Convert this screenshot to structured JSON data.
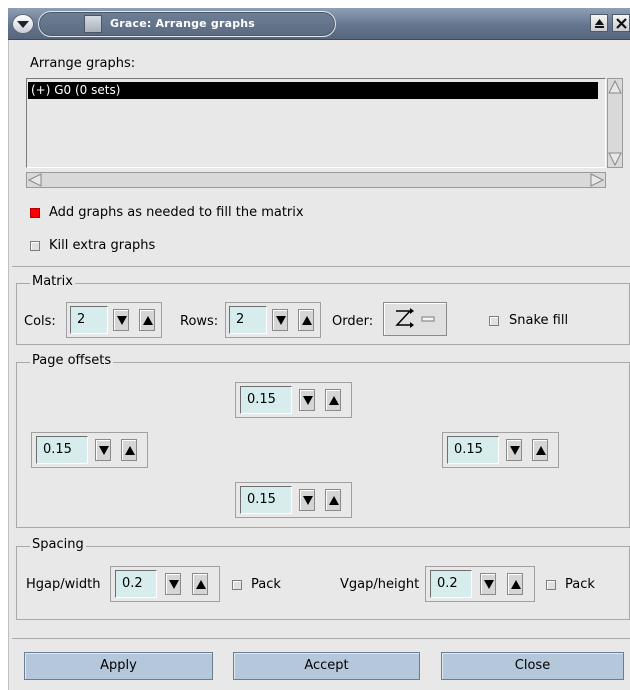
{
  "window": {
    "title": "Grace: Arrange graphs",
    "menu_icon": "chevron-down-icon",
    "app_icon": "grace-app-icon",
    "controls": [
      "maximize-icon",
      "close-icon"
    ]
  },
  "graphs": {
    "label": "Arrange graphs:",
    "items": [
      "(+) G0 (0 sets)"
    ],
    "add_graphs": {
      "label": "Add graphs as needed to fill the matrix",
      "checked": true
    },
    "kill_extra": {
      "label": "Kill extra graphs",
      "checked": false
    }
  },
  "matrix": {
    "title": "Matrix",
    "cols_label": "Cols:",
    "cols_value": "2",
    "rows_label": "Rows:",
    "rows_value": "2",
    "order_label": "Order:",
    "order_icon": "order-zigzag-icon",
    "snake_fill": {
      "label": "Snake fill",
      "checked": false
    }
  },
  "page_offsets": {
    "title": "Page offsets",
    "top": "0.15",
    "left": "0.15",
    "right": "0.15",
    "bottom": "0.15"
  },
  "spacing": {
    "title": "Spacing",
    "hgap_label": "Hgap/width",
    "hgap_value": "0.2",
    "hpack": {
      "label": "Pack",
      "checked": false
    },
    "vgap_label": "Vgap/height",
    "vgap_value": "0.2",
    "vpack": {
      "label": "Pack",
      "checked": false
    }
  },
  "buttons": {
    "apply": "Apply",
    "accept": "Accept",
    "close": "Close"
  },
  "colors": {
    "titlebar": "#64758d",
    "dialog_bg": "#e8e8e8",
    "input_bg": "#d7eded",
    "toggle_on": "#ff0000",
    "button_bg": "#b5c7db"
  }
}
